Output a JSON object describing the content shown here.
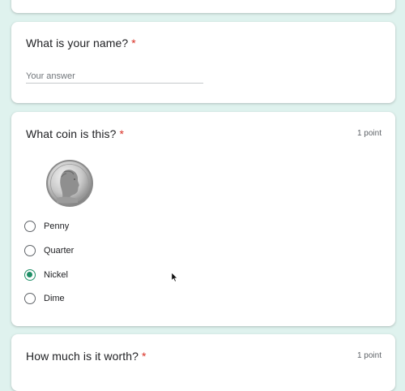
{
  "name_question": {
    "title": "What is your name?",
    "required_mark": "*",
    "placeholder": "Your answer"
  },
  "coin_question": {
    "title": "What coin is this?",
    "required_mark": "*",
    "points": "1 point",
    "image_icon": "nickel-coin-image",
    "options": [
      {
        "label": "Penny",
        "selected": false
      },
      {
        "label": "Quarter",
        "selected": false
      },
      {
        "label": "Nickel",
        "selected": true
      },
      {
        "label": "Dime",
        "selected": false
      }
    ]
  },
  "worth_question": {
    "title": "How much is it worth?",
    "required_mark": "*",
    "points": "1 point"
  },
  "colors": {
    "background": "#dff2ee",
    "accent": "#1e8e66",
    "required": "#d93025"
  }
}
